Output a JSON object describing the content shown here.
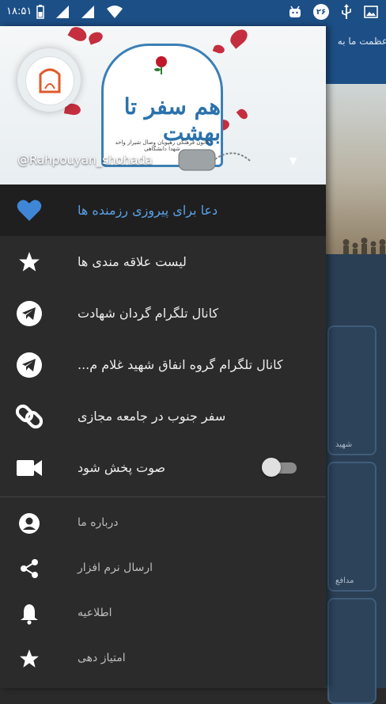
{
  "statusbar": {
    "time": "۱۸:۵۱",
    "badge": "۲۶"
  },
  "background": {
    "header_text": "عظمت ما به",
    "tiles": [
      "شهید",
      "مدافع"
    ]
  },
  "drawer": {
    "header": {
      "handle": "@Rahpouyan_shohada",
      "title_art": "هم سفر تا بهشت",
      "subtitle": "کانون فرهنگی رهپویان وصال شیراز واحد شهدا دانشگاهی"
    },
    "items": [
      {
        "label": "دعا برای پیروزی رزمنده ها",
        "icon": "heart-icon",
        "active": true
      },
      {
        "label": "لیست علاقه مندی ها",
        "icon": "star-icon"
      },
      {
        "label": "کانال تلگرام گردان شهادت",
        "icon": "telegram-icon"
      },
      {
        "label": "کانال تلگرام گروه انفاق شهید غلام م...",
        "icon": "telegram-icon"
      },
      {
        "label": "سفر جنوب در جامعه مجازی",
        "icon": "link-icon"
      },
      {
        "label": "صوت پخش شود",
        "icon": "video-camera-icon",
        "toggle": false
      }
    ],
    "secondary": [
      {
        "label": "درباره ما",
        "icon": "account-circle-icon"
      },
      {
        "label": "ارسال نرم افزار",
        "icon": "share-icon"
      },
      {
        "label": "اطلاعیه",
        "icon": "bell-icon"
      },
      {
        "label": "امتیاز دهی",
        "icon": "star-icon"
      }
    ]
  }
}
